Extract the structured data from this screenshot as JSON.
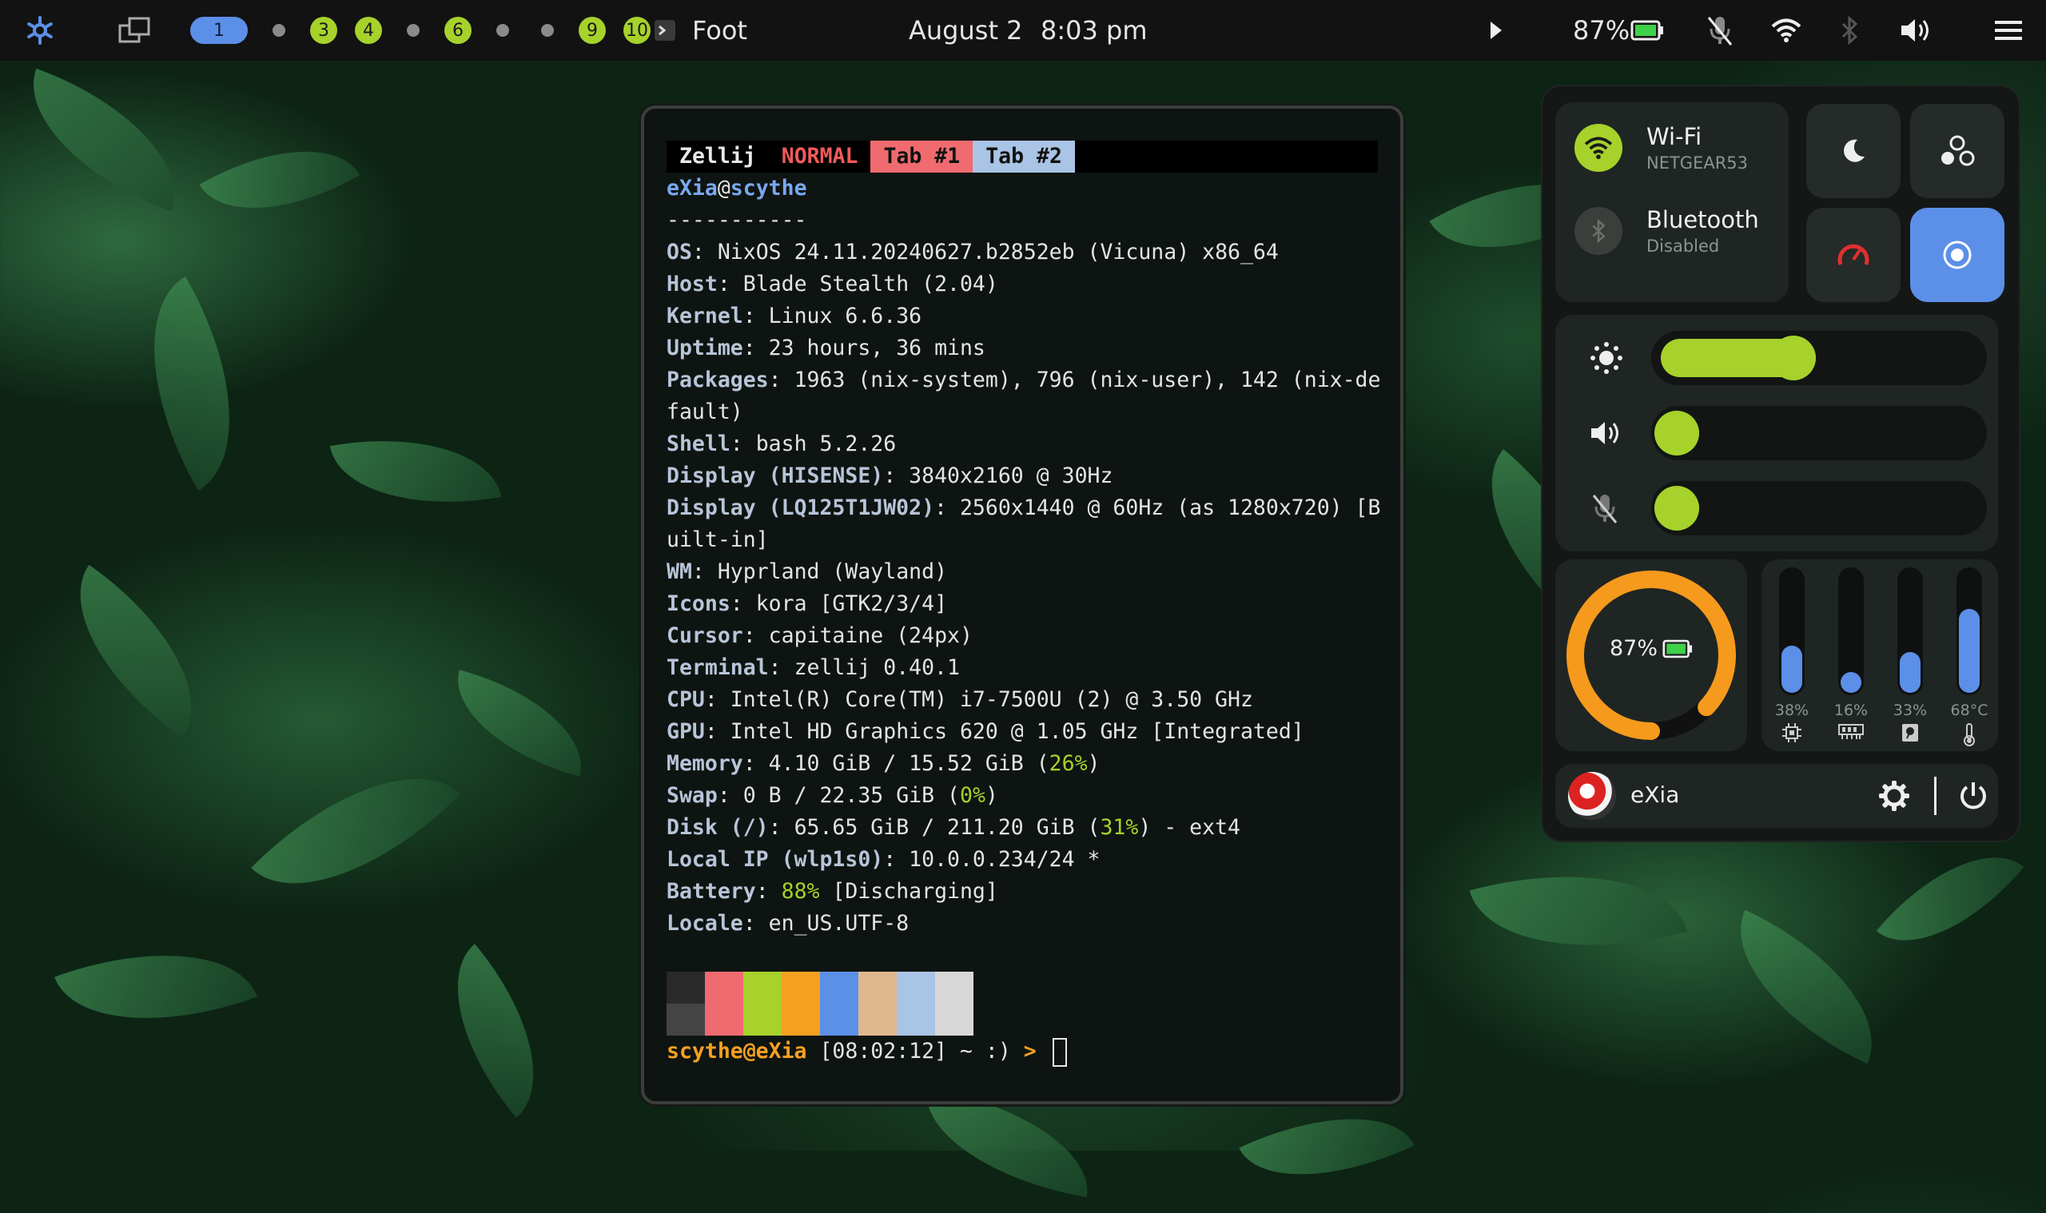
{
  "topbar": {
    "workspaces": [
      {
        "label": "1",
        "state": "active"
      },
      {
        "label": "",
        "state": "empty"
      },
      {
        "label": "3",
        "state": "occupied"
      },
      {
        "label": "4",
        "state": "occupied"
      },
      {
        "label": "",
        "state": "empty"
      },
      {
        "label": "6",
        "state": "occupied"
      },
      {
        "label": "",
        "state": "empty"
      },
      {
        "label": "",
        "state": "empty"
      },
      {
        "label": "9",
        "state": "occupied"
      },
      {
        "label": "10",
        "state": "occupied"
      }
    ],
    "window_title": "Foot",
    "date": "August 2",
    "time": "8:03 pm",
    "battery_percent": "87%",
    "colors": {
      "active": "#5c8fe8",
      "occupied": "#a6d22b",
      "empty": "#8a8a8a"
    }
  },
  "terminal": {
    "zellij": {
      "name": "Zellij",
      "mode": "NORMAL",
      "tabs": [
        "Tab #1",
        "Tab #2"
      ]
    },
    "user": "eXia",
    "at": "@",
    "host": "scythe",
    "separator": "-----------",
    "info": [
      {
        "key": "OS",
        "value": "NixOS 24.11.20240627.b2852eb (Vicuna) x86_64"
      },
      {
        "key": "Host",
        "value": "Blade Stealth (2.04)"
      },
      {
        "key": "Kernel",
        "value": "Linux 6.6.36"
      },
      {
        "key": "Uptime",
        "value": "23 hours, 36 mins"
      },
      {
        "key": "Packages",
        "value": "1963 (nix-system), 796 (nix-user), 142 (nix-de"
      },
      {
        "key": "",
        "value": "fault)"
      },
      {
        "key": "Shell",
        "value": "bash 5.2.26"
      },
      {
        "key": "Display (HISENSE)",
        "value": "3840x2160 @ 30Hz"
      },
      {
        "key": "Display (LQ125T1JW02)",
        "value": "2560x1440 @ 60Hz (as 1280x720) [B"
      },
      {
        "key": "",
        "value": "uilt-in]"
      },
      {
        "key": "WM",
        "value": "Hyprland (Wayland)"
      },
      {
        "key": "Icons",
        "value": "kora [GTK2/3/4]"
      },
      {
        "key": "Cursor",
        "value": "capitaine (24px)"
      },
      {
        "key": "Terminal",
        "value": "zellij 0.40.1"
      },
      {
        "key": "CPU",
        "value": "Intel(R) Core(TM) i7-7500U (2) @ 3.50 GHz"
      },
      {
        "key": "GPU",
        "value": "Intel HD Graphics 620 @ 1.05 GHz [Integrated]"
      },
      {
        "key": "Memory",
        "value": "4.10 GiB / 15.52 GiB (",
        "highlight": "26%",
        "tail": ")"
      },
      {
        "key": "Swap",
        "value": "0 B / 22.35 GiB (",
        "highlight": "0%",
        "tail": ")"
      },
      {
        "key": "Disk (/)",
        "value": "65.65 GiB / 211.20 GiB (",
        "highlight": "31%",
        "tail": ") - ext4"
      },
      {
        "key": "Local IP (wlp1s0)",
        "value": "10.0.0.234/24 *"
      },
      {
        "key": "Battery",
        "value": "",
        "highlight": "88%",
        "tail": " [Discharging]"
      },
      {
        "key": "Locale",
        "value": "en_US.UTF-8"
      }
    ],
    "palette": {
      "top": [
        "#2a2a2a",
        "#ef6b6f",
        "#a6d22b",
        "#f5a020",
        "#5c8fe8",
        "#e0b88e",
        "#a9c4e4",
        "#d8d8d8"
      ],
      "bottom": [
        "#444444",
        "#ef6b6f",
        "#a6d22b",
        "#f5a020",
        "#5c8fe8",
        "#e0b88e",
        "#a9c4e4",
        "#d8d8d8"
      ]
    },
    "prompt": {
      "user_host": "scythe@eXia",
      "time": "[08:02:12]",
      "path": "~ :)",
      "arrow": ">"
    }
  },
  "panel": {
    "wifi": {
      "title": "Wi-Fi",
      "sub": "NETGEAR53"
    },
    "bluetooth": {
      "title": "Bluetooth",
      "sub": "Disabled"
    },
    "sliders": [
      {
        "name": "brightness",
        "value": 0.42
      },
      {
        "name": "volume",
        "value": 0
      },
      {
        "name": "microphone",
        "value": 0
      }
    ],
    "battery_ring": {
      "label": "87%",
      "value": 0.87
    },
    "meters": [
      {
        "label": "38%",
        "value": 0.38,
        "icon": "cpu"
      },
      {
        "label": "16%",
        "value": 0.16,
        "icon": "ram"
      },
      {
        "label": "33%",
        "value": 0.33,
        "icon": "disk"
      },
      {
        "label": "68°C",
        "value": 0.68,
        "icon": "temperature"
      }
    ],
    "user": {
      "name": "eXia"
    }
  }
}
